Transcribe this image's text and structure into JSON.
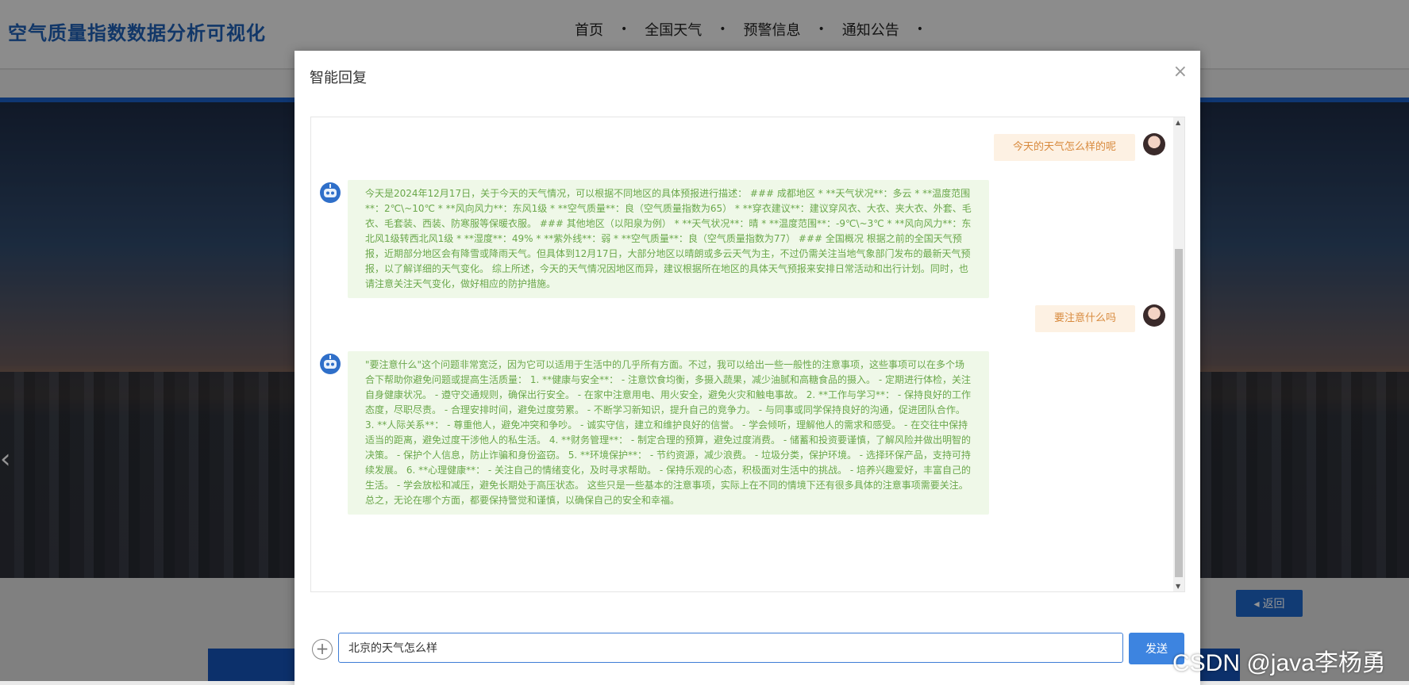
{
  "site": {
    "title": "空气质量指数数据分析可视化",
    "nav": [
      "首页",
      "全国天气",
      "预警信息",
      "通知公告"
    ],
    "nav_separator": "•",
    "back_label": "返回"
  },
  "modal": {
    "title": "智能回复",
    "close_symbol": "×",
    "messages": [
      {
        "role": "user",
        "text": "今天的天气怎么样的呢"
      },
      {
        "role": "bot",
        "text": "今天是2024年12月17日，关于今天的天气情况，可以根据不同地区的具体预报进行描述： ### 成都地区 * **天气状况**：多云 * **温度范围**：2℃\\~10℃ * **风向风力**：东风1级 * **空气质量**：良（空气质量指数为65） * **穿衣建议**：建议穿风衣、大衣、夹大衣、外套、毛衣、毛套装、西装、防寒服等保暖衣服。 ### 其他地区（以阳泉为例） * **天气状况**：晴 * **温度范围**：-9℃\\~3℃ * **风向风力**：东北风1级转西北风1级 * **湿度**：49% * **紫外线**：弱 * **空气质量**：良（空气质量指数为77） ### 全国概况 根据之前的全国天气预报，近期部分地区会有降雪或降雨天气。但具体到12月17日，大部分地区以晴朗或多云天气为主，不过仍需关注当地气象部门发布的最新天气预报，以了解详细的天气变化。 综上所述，今天的天气情况因地区而异，建议根据所在地区的具体天气预报来安排日常活动和出行计划。同时，也请注意关注天气变化，做好相应的防护措施。"
      },
      {
        "role": "user",
        "text": "要注意什么吗"
      },
      {
        "role": "bot",
        "text": "\"要注意什么\"这个问题非常宽泛，因为它可以适用于生活中的几乎所有方面。不过，我可以给出一些一般性的注意事项，这些事项可以在多个场合下帮助你避免问题或提高生活质量： 1. **健康与安全**： - 注意饮食均衡，多摄入蔬果，减少油腻和高糖食品的摄入。 - 定期进行体检，关注自身健康状况。 - 遵守交通规则，确保出行安全。 - 在家中注意用电、用火安全，避免火灾和触电事故。 2. **工作与学习**： - 保持良好的工作态度，尽职尽责。 - 合理安排时间，避免过度劳累。 - 不断学习新知识，提升自己的竞争力。 - 与同事或同学保持良好的沟通，促进团队合作。 3. **人际关系**： - 尊重他人，避免冲突和争吵。 - 诚实守信，建立和维护良好的信誉。 - 学会倾听，理解他人的需求和感受。 - 在交往中保持适当的距离，避免过度干涉他人的私生活。 4. **财务管理**： - 制定合理的预算，避免过度消费。 - 储蓄和投资要谨慎，了解风险并做出明智的决策。 - 保护个人信息，防止诈骗和身份盗窃。 5. **环境保护**： - 节约资源，减少浪费。 - 垃圾分类，保护环境。 - 选择环保产品，支持可持续发展。 6. **心理健康**： - 关注自己的情绪变化，及时寻求帮助。 - 保持乐观的心态，积极面对生活中的挑战。 - 培养兴趣爱好，丰富自己的生活。 - 学会放松和减压，避免长期处于高压状态。 这些只是一些基本的注意事项，实际上在不同的情境下还有很多具体的注意事项需要关注。总之，无论在哪个方面，都要保持警觉和谨慎，以确保自己的安全和幸福。"
      }
    ],
    "input_value": "北京的天气怎么样",
    "send_label": "发送"
  },
  "watermark": "CSDN @java李杨勇",
  "icons": {
    "plus": "plus-circle-icon",
    "close": "close-icon",
    "bot_avatar": "robot-icon",
    "user_avatar": "user-avatar-icon",
    "back": "caret-left-icon"
  },
  "colors": {
    "brand_blue": "#1f5fb3",
    "send_button": "#3d84e0",
    "user_bubble_bg": "#fdf1e3",
    "user_bubble_text": "#d88a3e",
    "bot_bubble_bg": "#eff8e8",
    "bot_bubble_text": "#6aa74a"
  }
}
